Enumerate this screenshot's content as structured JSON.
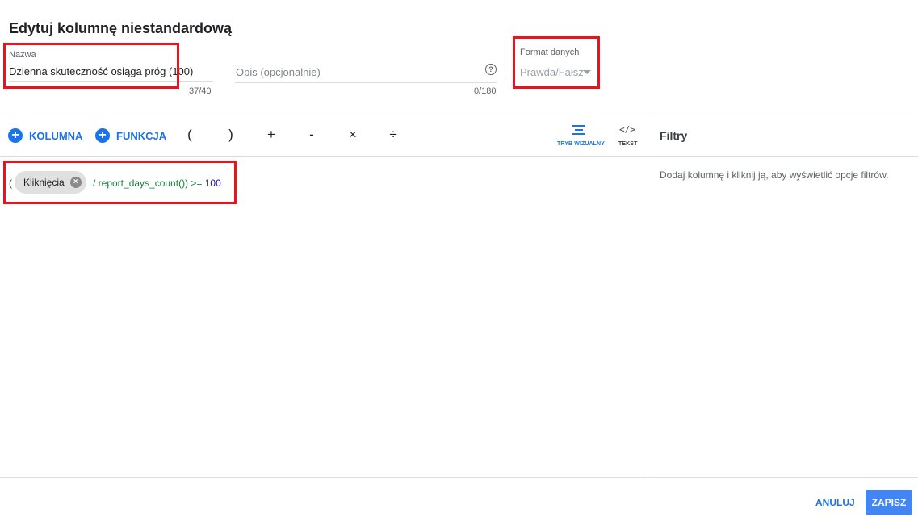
{
  "dialog": {
    "title": "Edytuj kolumnę niestandardową"
  },
  "name_field": {
    "label": "Nazwa",
    "value": "Dzienna skuteczność osiąga próg (100)",
    "counter": "37/40"
  },
  "description_field": {
    "placeholder": "Opis (opcjonalnie)",
    "counter": "0/180",
    "help_icon": "help-icon"
  },
  "format_field": {
    "label": "Format danych",
    "value": "Prawda/Fałsz"
  },
  "toolbar": {
    "column_label": "KOLUMNA",
    "function_label": "FUNKCJA",
    "operators": [
      "(",
      ")",
      "+",
      "-",
      "×",
      "÷"
    ],
    "visual_mode_label": "TRYB WIZUALNY",
    "text_mode_label": "TEKST"
  },
  "formula": {
    "open_paren": "(",
    "chip_label": "Kliknięcia",
    "rest": "/ report_days_count()) >= ",
    "number": "100"
  },
  "filters": {
    "title": "Filtry",
    "hint": "Dodaj kolumnę i kliknij ją, aby wyświetlić opcje filtrów."
  },
  "footer": {
    "cancel_label": "ANULUJ",
    "save_label": "ZAPISZ"
  },
  "colors": {
    "accent": "#1a73e8",
    "save_button": "#4285f4",
    "highlight_box": "#e8131c",
    "formula_number": "#1a0dab"
  }
}
